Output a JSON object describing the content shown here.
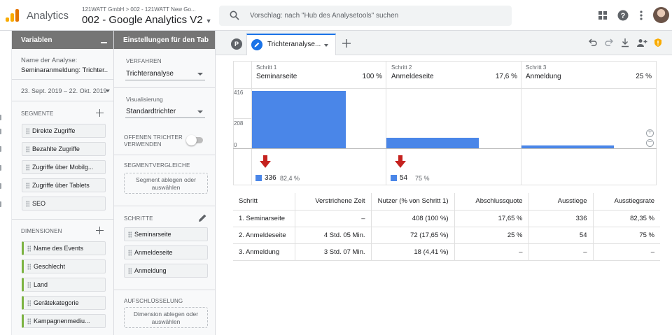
{
  "topbar": {
    "app_title": "Analytics",
    "breadcrumb": "121WATT GmbH  >  002 - 121WATT New Go...",
    "view_title": "002 - Google Analytics V2",
    "search_placeholder": "Vorschlag: nach \"Hub des Analysetools\" suchen",
    "icons": [
      "apps-grid-icon",
      "help-icon",
      "more-vert-icon",
      "avatar"
    ]
  },
  "variables_panel": {
    "title": "Variablen",
    "analysis_name_label": "Name der Analyse:",
    "analysis_name_value": "Seminaranmeldung: Trichter...",
    "date_range": "23. Sept. 2019 – 22. Okt. 2019",
    "segments_label": "SEGMENTE",
    "segments": [
      "Direkte Zugriffe",
      "Bezahlte Zugriffe",
      "Zugriffe über Mobilg...",
      "Zugriffe über Tablets",
      "SEO"
    ],
    "dimensions_label": "DIMENSIONEN",
    "dimensions": [
      "Name des Events",
      "Geschlecht",
      "Land",
      "Gerätekategorie",
      "Kampagnenmediu..."
    ]
  },
  "settings_panel": {
    "title": "Einstellungen für den Tab",
    "technique_label": "VERFAHREN",
    "technique_value": "Trichteranalyse",
    "visualization_label": "Visualisierung",
    "visualization_value": "Standardtrichter",
    "open_funnel_label": "OFFENEN TRICHTER VERWENDEN",
    "open_funnel_enabled": false,
    "segment_compare_label": "SEGMENTVERGLEICHE",
    "segment_drop_text": "Segment ablegen oder auswählen",
    "steps_label": "SCHRITTE",
    "steps": [
      "Seminarseite",
      "Anmeldeseite",
      "Anmeldung"
    ],
    "breakdown_label": "AUFSCHLÜSSELUNG",
    "dimension_drop_text": "Dimension ablegen oder auswählen"
  },
  "tabs": {
    "p_badge": "P",
    "active_tab": "Trichteranalyse..."
  },
  "chart_data": {
    "type": "bar",
    "categories": [
      "Seminarseite",
      "Anmeldeseite",
      "Anmeldung"
    ],
    "step_numbers": [
      "Schritt 1",
      "Schritt 2",
      "Schritt 3"
    ],
    "step_percent_labels": [
      "100 %",
      "17,6 %",
      "25 %"
    ],
    "values": [
      408,
      72,
      18
    ],
    "y_ticks": [
      "416",
      "208",
      "0"
    ],
    "ylim": [
      0,
      416
    ],
    "abandonments": [
      {
        "value": "336",
        "percent": "82,4 %"
      },
      {
        "value": "54",
        "percent": "75 %"
      }
    ],
    "bar_color": "#4a86e8",
    "arrow_color": "#c5221f"
  },
  "table": {
    "headers": [
      "Schritt",
      "Verstrichene Zeit",
      "Nutzer (% von Schritt 1)",
      "Abschlussquote",
      "Ausstiege",
      "Ausstiegsrate"
    ],
    "rows": [
      [
        "1. Seminarseite",
        "–",
        "408 (100 %)",
        "17,65 %",
        "336",
        "82,35 %"
      ],
      [
        "2. Anmeldeseite",
        "4 Std. 05 Min.",
        "72 (17,65 %)",
        "25 %",
        "54",
        "75 %"
      ],
      [
        "3. Anmeldung",
        "3 Std. 07 Min.",
        "18 (4,41 %)",
        "–",
        "–",
        "–"
      ]
    ]
  }
}
